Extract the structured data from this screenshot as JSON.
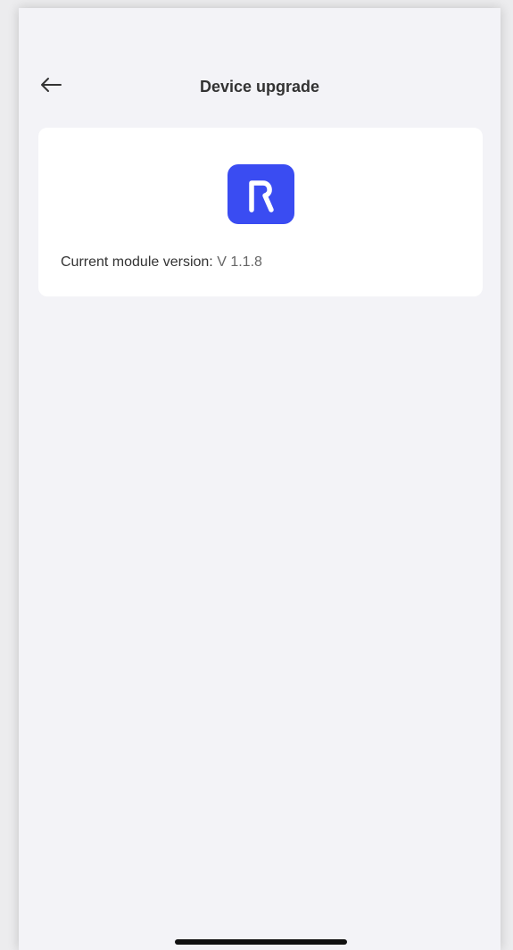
{
  "header": {
    "title": "Device upgrade",
    "back_icon": "arrow-left-icon"
  },
  "card": {
    "logo_icon": "app-logo-r-icon",
    "logo_color": "#3a4cf2",
    "version_label": "Current module version:",
    "version_value": "V 1.1.8"
  },
  "colors": {
    "background": "#f3f3f7",
    "card": "#ffffff",
    "title_text": "#333333",
    "accent": "#3a4cf2"
  }
}
